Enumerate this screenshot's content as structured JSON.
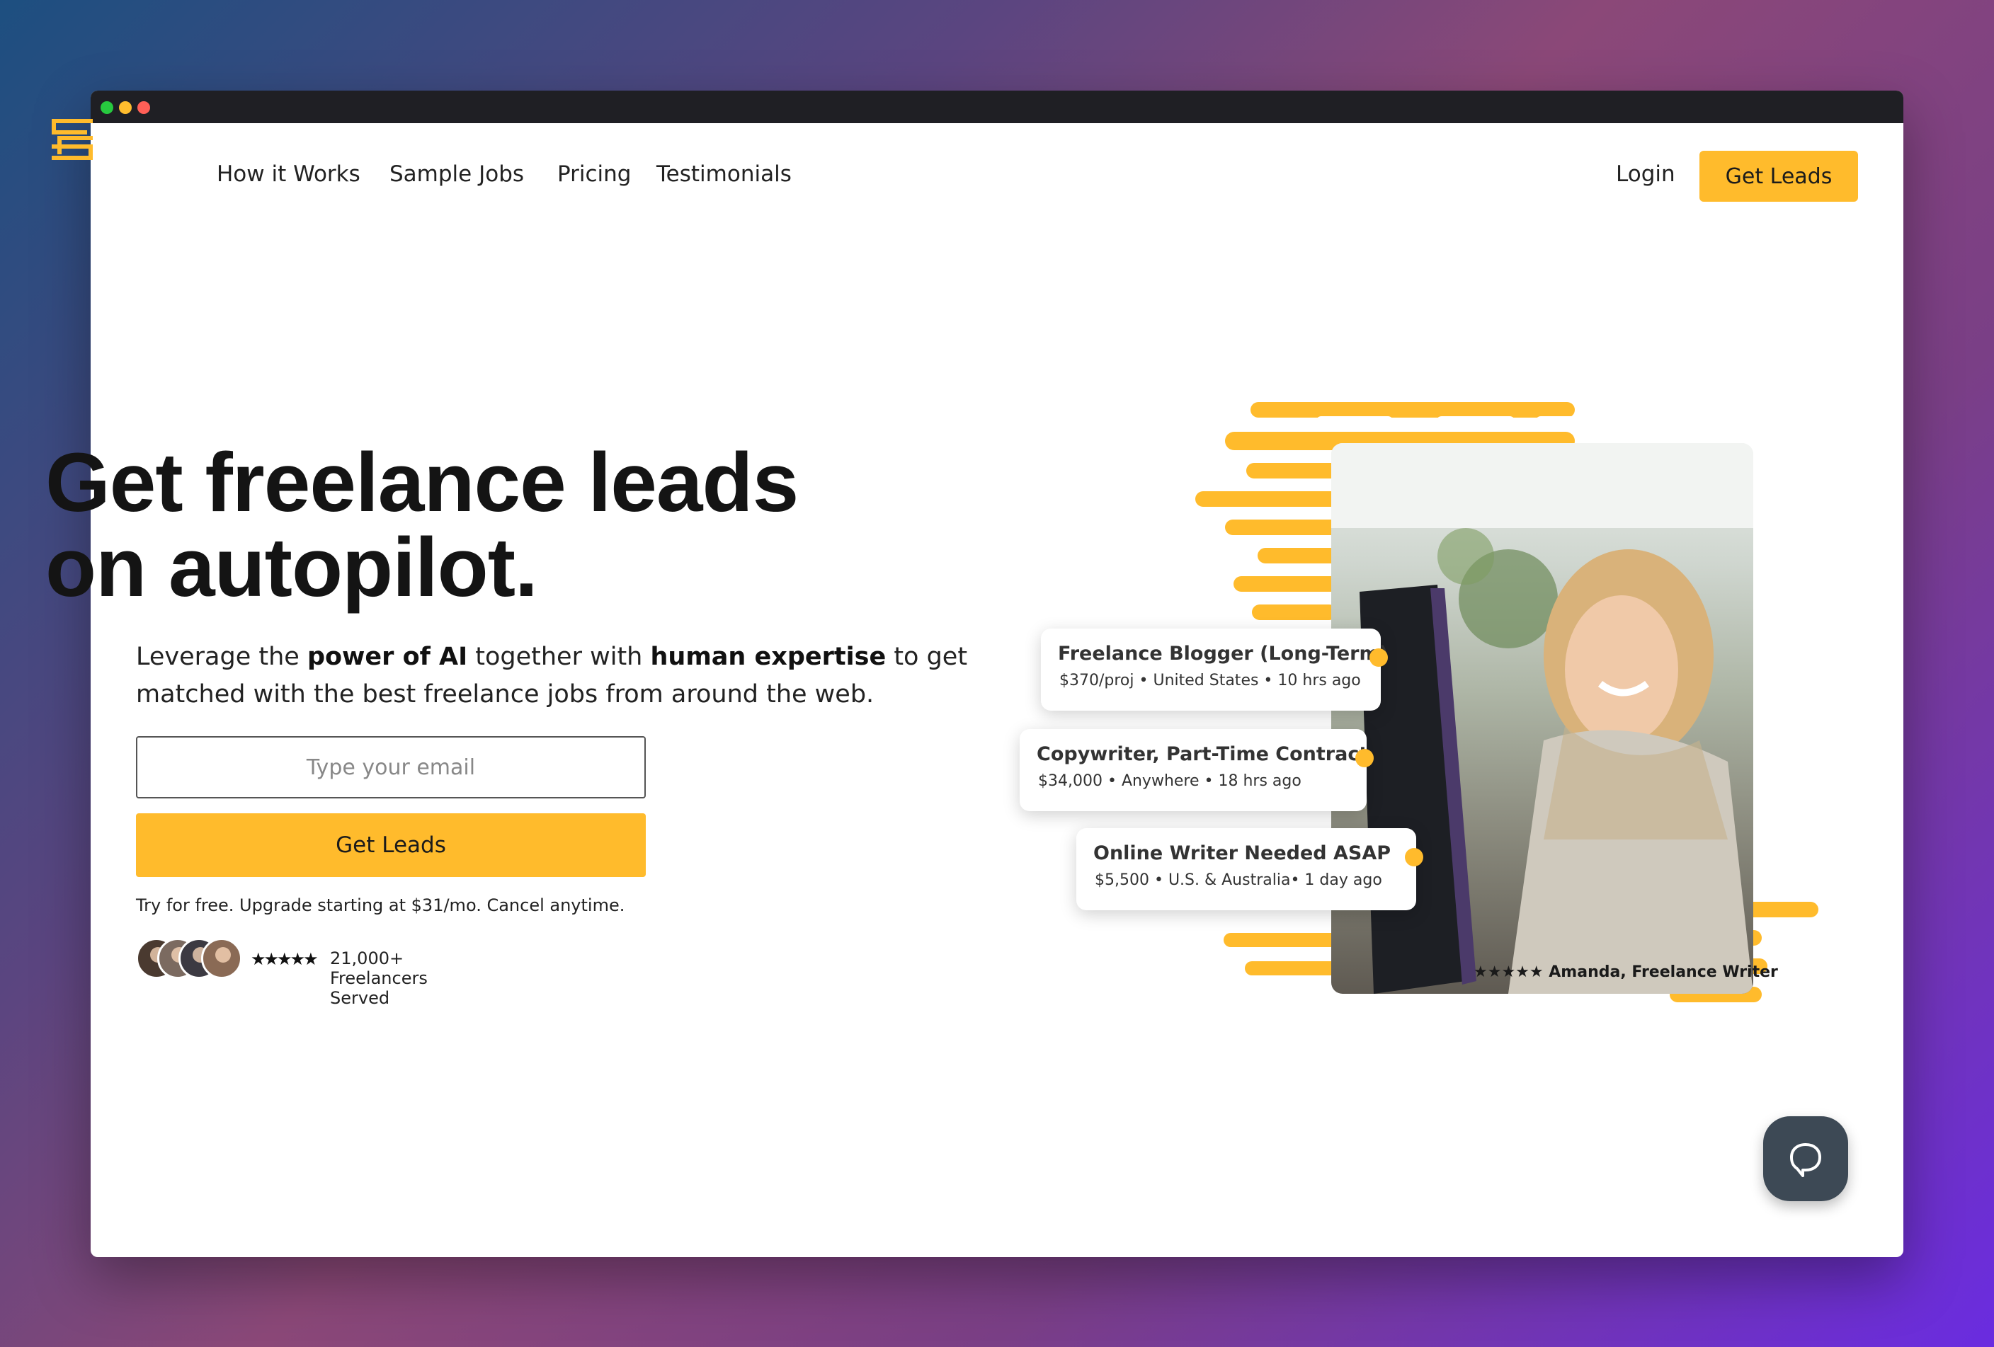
{
  "window_dots": [
    "#27c93f",
    "#ffbd2e",
    "#ff5f57"
  ],
  "accent_color": "#ffbb2c",
  "nav": {
    "links": [
      "How it Works",
      "Sample Jobs",
      "Pricing",
      "Testimonials"
    ],
    "login": "Login",
    "cta": "Get Leads"
  },
  "hero": {
    "headline_line1": "Get freelance leads",
    "headline_line2": "on autopilot.",
    "sub_1": "Leverage the ",
    "sub_bold_1": "power of AI",
    "sub_2": " together with ",
    "sub_bold_2": "human expertise",
    "sub_3": " to get matched with the best freelance jobs from around the web.",
    "email_placeholder": "Type your email",
    "cta": "Get Leads",
    "fine_print": "Try for free. Upgrade starting at $31/mo. Cancel anytime.",
    "rating_stars": "★★★★★",
    "rating_value": 4.5,
    "served": "21,000+ Freelancers Served"
  },
  "job_cards": [
    {
      "title": "Freelance Blogger (Long-Term)",
      "meta": "$370/proj • United States • 10 hrs ago"
    },
    {
      "title": "Copywriter, Part-Time Contract",
      "meta": "$34,000 • Anywhere • 18 hrs ago"
    },
    {
      "title": "Online Writer Needed ASAP",
      "meta": "$5,500 • U.S. & Australia• 1 day ago"
    }
  ],
  "testimonial_caption": "★★★★★ Amanda, Freelance Writer",
  "icons": [
    "logo-icon",
    "chat-bubble-icon",
    "star-icon"
  ]
}
